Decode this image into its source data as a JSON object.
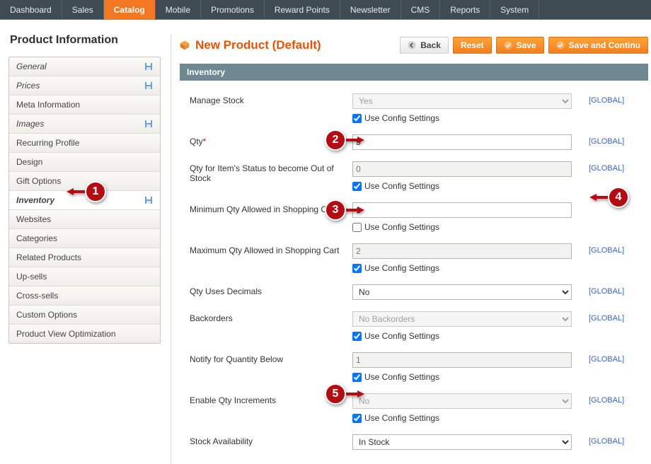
{
  "nav": {
    "items": [
      "Dashboard",
      "Sales",
      "Catalog",
      "Mobile",
      "Promotions",
      "Reward Points",
      "Newsletter",
      "CMS",
      "Reports",
      "System"
    ],
    "active_index": 2
  },
  "sidebar": {
    "title": "Product Information",
    "tabs": [
      {
        "label": "General",
        "italic": true
      },
      {
        "label": "Prices",
        "italic": true
      },
      {
        "label": "Meta Information"
      },
      {
        "label": "Images",
        "italic": true
      },
      {
        "label": "Recurring Profile"
      },
      {
        "label": "Design"
      },
      {
        "label": "Gift Options"
      },
      {
        "label": "Inventory",
        "italic": true,
        "active": true
      },
      {
        "label": "Websites"
      },
      {
        "label": "Categories"
      },
      {
        "label": "Related Products"
      },
      {
        "label": "Up-sells"
      },
      {
        "label": "Cross-sells"
      },
      {
        "label": "Custom Options"
      },
      {
        "label": "Product View Optimization"
      }
    ]
  },
  "toolbar": {
    "title": "New Product (Default)",
    "back": "Back",
    "reset": "Reset",
    "save": "Save",
    "save_continue": "Save and Continu"
  },
  "section": {
    "title": "Inventory",
    "scope": "[GLOBAL]",
    "use_config": "Use Config Settings",
    "fields": {
      "manage_stock": {
        "label": "Manage Stock",
        "value": "Yes",
        "cfg": true,
        "disabled": true
      },
      "qty": {
        "label": "Qty",
        "required": true,
        "value": "5"
      },
      "qty_oos": {
        "label": "Qty for Item's Status to become Out of Stock",
        "value": "0",
        "cfg": true,
        "disabled": true
      },
      "min_qty_cart": {
        "label": "Minimum Qty Allowed in Shopping Cart",
        "value": "1",
        "cfg": false
      },
      "max_qty_cart": {
        "label": "Maximum Qty Allowed in Shopping Cart",
        "value": "2",
        "cfg": true,
        "disabled": true
      },
      "qty_decimals": {
        "label": "Qty Uses Decimals",
        "value": "No"
      },
      "backorders": {
        "label": "Backorders",
        "value": "No Backorders",
        "cfg": true,
        "disabled": true
      },
      "notify_below": {
        "label": "Notify for Quantity Below",
        "value": "1",
        "cfg": true,
        "disabled": true
      },
      "enable_incr": {
        "label": "Enable Qty Increments",
        "value": "No",
        "cfg": true,
        "disabled": true
      },
      "stock_avail": {
        "label": "Stock Availability",
        "value": "In Stock"
      }
    }
  },
  "callouts": {
    "1": "1",
    "2": "2",
    "3": "3",
    "4": "4",
    "5": "5"
  }
}
